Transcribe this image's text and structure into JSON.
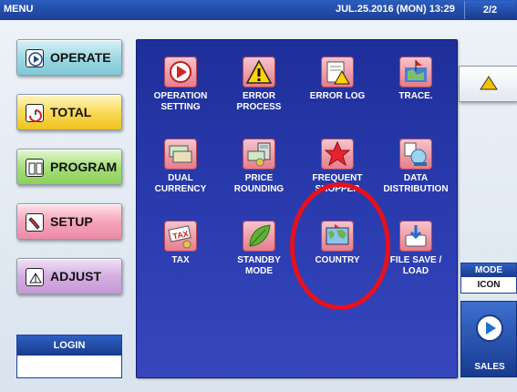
{
  "header": {
    "title": "MENU",
    "datetime": "JUL.25.2016 (MON) 13:29",
    "page": "2/2"
  },
  "left_menu": {
    "operate": "OPERATE",
    "total": "TOTAL",
    "program": "PROGRAM",
    "setup": "SETUP",
    "adjust": "ADJUST"
  },
  "login": {
    "label": "LOGIN"
  },
  "tiles": [
    {
      "l1": "OPERATION",
      "l2": "SETTING",
      "icon": "operation-setting-icon"
    },
    {
      "l1": "ERROR",
      "l2": "PROCESS",
      "icon": "warning-icon"
    },
    {
      "l1": "ERROR LOG",
      "l2": "",
      "icon": "error-log-icon"
    },
    {
      "l1": "TRACE.",
      "l2": "",
      "icon": "trace-icon"
    },
    {
      "l1": "DUAL",
      "l2": "CURRENCY",
      "icon": "dual-currency-icon"
    },
    {
      "l1": "PRICE",
      "l2": "ROUNDING",
      "icon": "price-rounding-icon"
    },
    {
      "l1": "FREQUENT",
      "l2": "SHOPPER",
      "icon": "star-icon"
    },
    {
      "l1": "DATA",
      "l2": "DISTRIBUTION",
      "icon": "data-distribution-icon"
    },
    {
      "l1": "TAX",
      "l2": "",
      "icon": "tax-icon"
    },
    {
      "l1": "STANDBY",
      "l2": "MODE",
      "icon": "leaf-icon"
    },
    {
      "l1": "COUNTRY",
      "l2": "",
      "icon": "world-map-icon"
    },
    {
      "l1": "FILE SAVE /",
      "l2": "LOAD",
      "icon": "file-save-load-icon"
    }
  ],
  "right": {
    "mode_label": "MODE",
    "mode_value": "ICON",
    "sales_label": "SALES"
  },
  "colors": {
    "panel": "#2b3cb0",
    "accent_red": "#e8101a",
    "header": "#1c3f96"
  }
}
